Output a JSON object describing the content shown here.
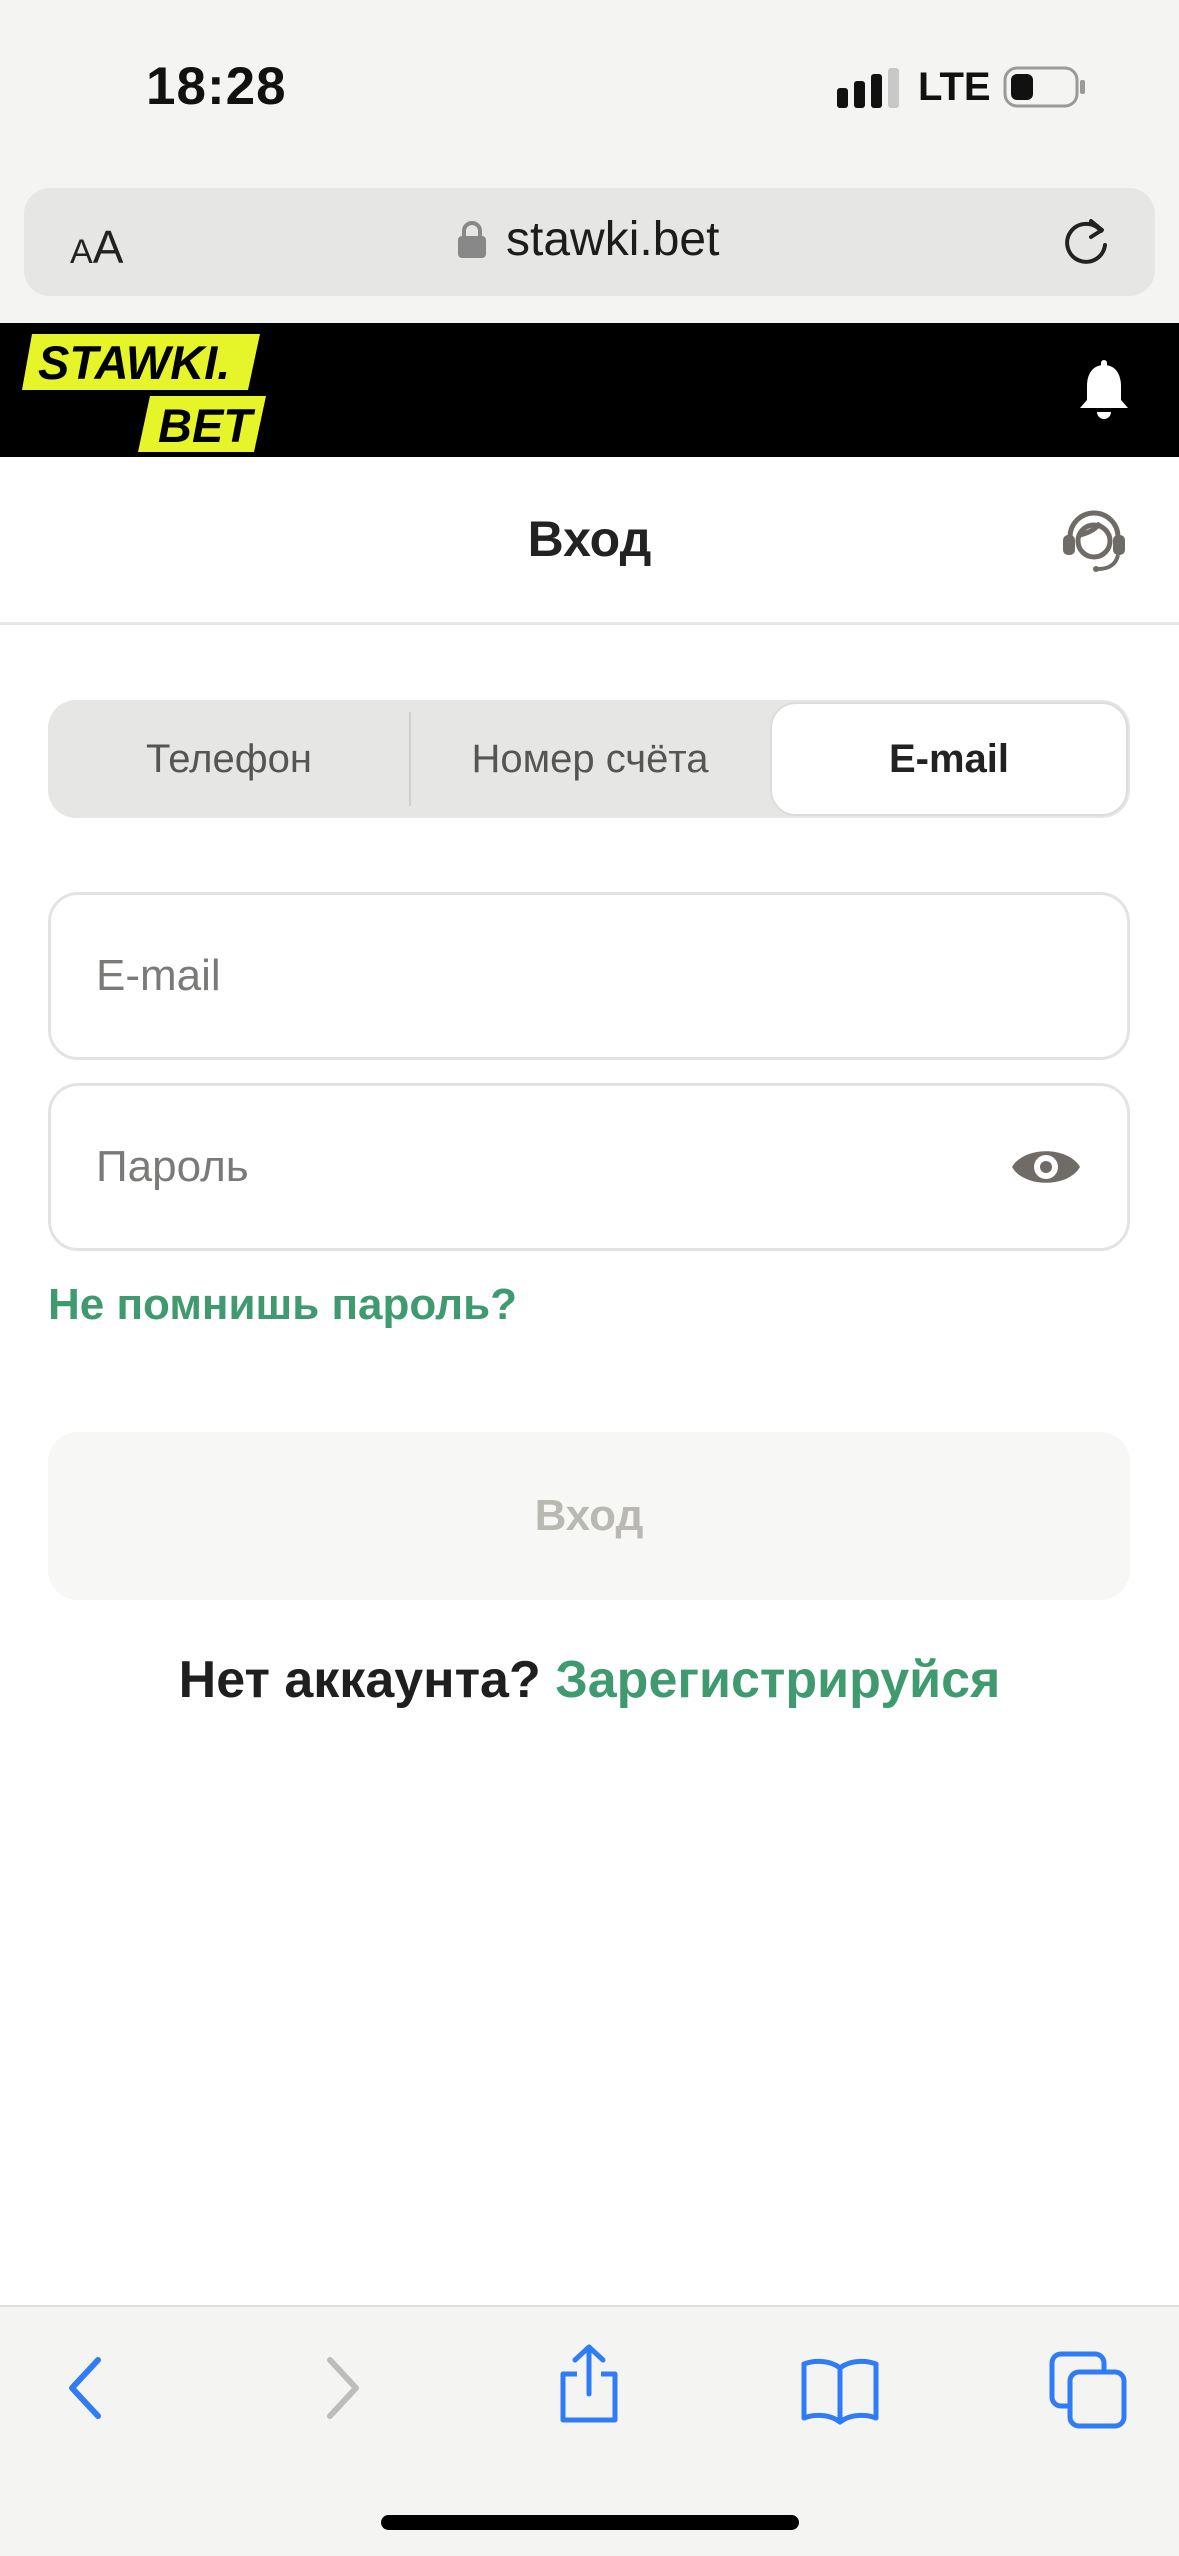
{
  "status_bar": {
    "time": "18:28",
    "network": "LTE",
    "icons": [
      "signal-icon",
      "battery-icon"
    ]
  },
  "browser": {
    "text_size_small": "A",
    "text_size_big": "A",
    "url": "stawki.bet",
    "icons": [
      "lock-icon",
      "reload-icon"
    ],
    "toolbar_icons": [
      "back-icon",
      "forward-icon",
      "share-icon",
      "bookmarks-icon",
      "tabs-icon"
    ]
  },
  "site_header": {
    "logo_text_line1": "STAWKI.",
    "logo_text_line2": "BET",
    "icons": [
      "bell-icon"
    ]
  },
  "login": {
    "title": "Вход",
    "support_icon": "support-headset-icon",
    "tabs": [
      {
        "label": "Телефон",
        "active": false
      },
      {
        "label": "Номер счёта",
        "active": false
      },
      {
        "label": "E-mail",
        "active": true
      }
    ],
    "email_placeholder": "E-mail",
    "email_value": "",
    "password_placeholder": "Пароль",
    "password_value": "",
    "forgot_password": "Не помнишь пароль?",
    "submit_label": "Вход",
    "no_account": "Нет аккаунта?",
    "register_link": "Зарегистрируйся"
  },
  "colors": {
    "accent_green": "#3f9b6f",
    "logo_yellow": "#e6f52a",
    "header_black": "#000000",
    "ios_blue": "#2f7cf6"
  }
}
